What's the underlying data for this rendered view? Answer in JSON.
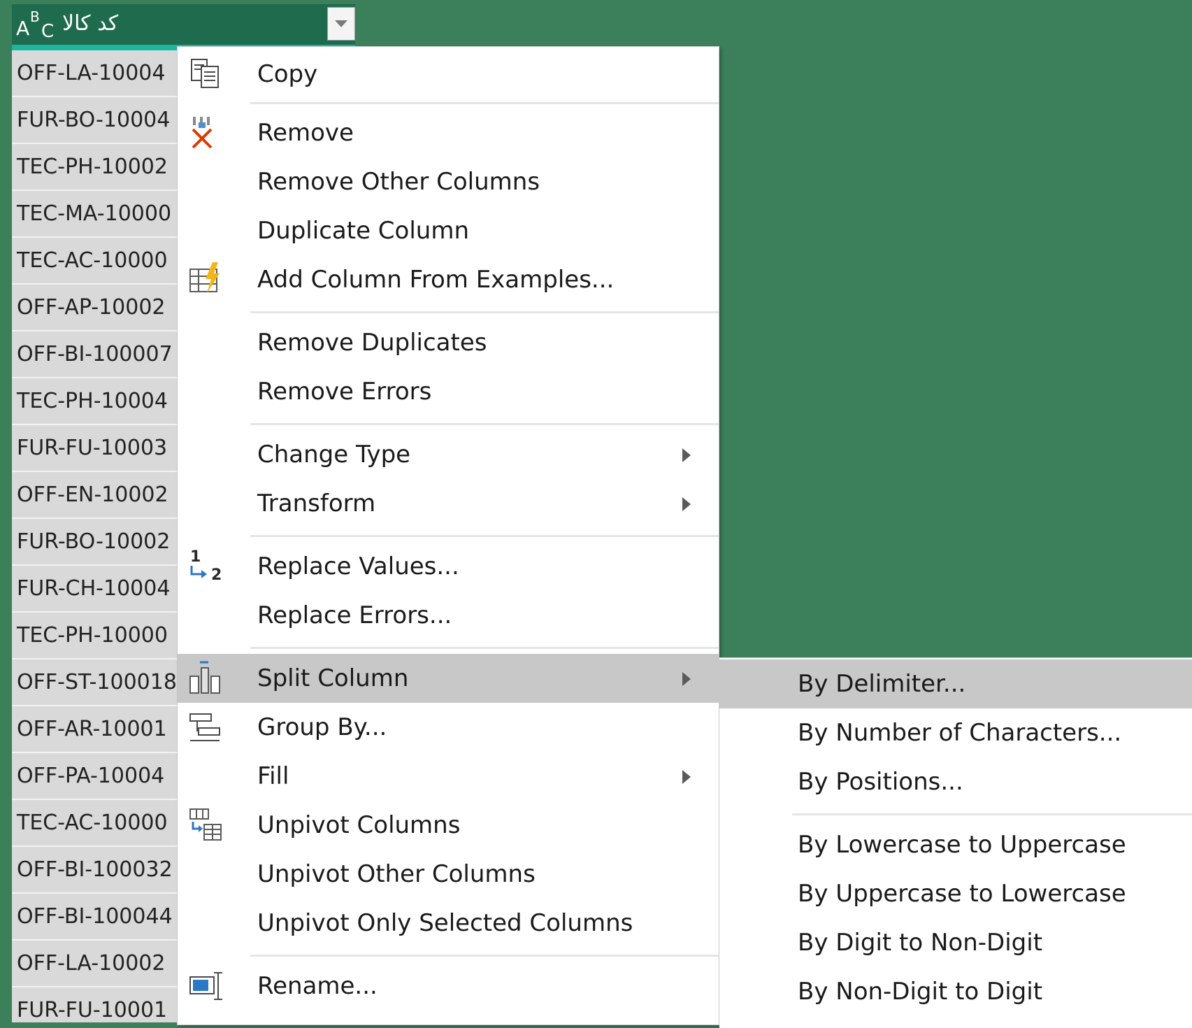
{
  "column": {
    "type_icon": {
      "a": "A",
      "b": "B",
      "c": "C"
    },
    "title": "کد کالا"
  },
  "rows": [
    "OFF-LA-10004",
    "FUR-BO-10004",
    "TEC-PH-10002",
    "TEC-MA-10000",
    "TEC-AC-10000",
    "OFF-AP-10002",
    "OFF-BI-100007",
    "TEC-PH-10004",
    "FUR-FU-10003",
    "OFF-EN-10002",
    "FUR-BO-10002",
    "FUR-CH-10004",
    "TEC-PH-10000",
    "OFF-ST-100018",
    "OFF-AR-10001",
    "OFF-PA-10004",
    "TEC-AC-10000",
    "OFF-BI-100032",
    "OFF-BI-100044",
    "OFF-LA-10002",
    "FUR-FU-10001"
  ],
  "menu": {
    "copy": "Copy",
    "remove": "Remove",
    "remove_other_columns": "Remove Other Columns",
    "duplicate_column": "Duplicate Column",
    "add_column_from_examples": "Add Column From Examples...",
    "remove_duplicates": "Remove Duplicates",
    "remove_errors": "Remove Errors",
    "change_type": "Change Type",
    "transform": "Transform",
    "replace_values": "Replace Values...",
    "replace_errors": "Replace Errors...",
    "split_column": "Split Column",
    "group_by": "Group By...",
    "fill": "Fill",
    "unpivot_columns": "Unpivot Columns",
    "unpivot_other_columns": "Unpivot Other Columns",
    "unpivot_only_selected": "Unpivot Only Selected Columns",
    "rename": "Rename..."
  },
  "replace_icon": {
    "one": "1",
    "two": "2"
  },
  "submenu": {
    "by_delimiter": "By Delimiter...",
    "by_number_of_characters": "By Number of Characters...",
    "by_positions": "By Positions...",
    "by_lowercase_to_uppercase": "By Lowercase to Uppercase",
    "by_uppercase_to_lowercase": "By Uppercase to Lowercase",
    "by_digit_to_non_digit": "By Digit to Non-Digit",
    "by_non_digit_to_digit": "By Non-Digit to Digit"
  },
  "colors": {
    "background": "#3b7f5b",
    "header": "#1f6b4e",
    "header_underline": "#1bb7a1",
    "highlight": "#c8c8c8",
    "remove_icon": "#d83b01",
    "replace_icon": "#2b78c5"
  }
}
